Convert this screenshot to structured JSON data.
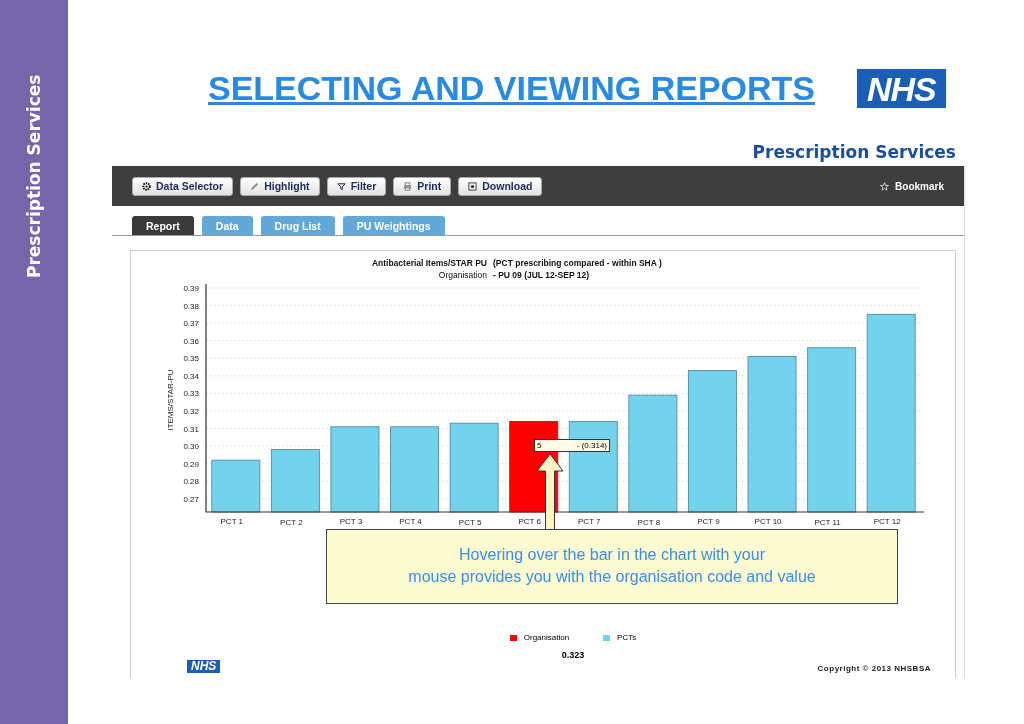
{
  "sidebar": {
    "title": "Prescription Services"
  },
  "slide": {
    "title": "SELECTING AND VIEWING REPORTS",
    "logo": "NHS",
    "subtitle": "Prescription Services"
  },
  "toolbar": {
    "buttons": [
      {
        "label": "Data Selector",
        "kind": "selector"
      },
      {
        "label": "Highlight",
        "kind": "pencil"
      },
      {
        "label": "Filter",
        "kind": "funnel"
      },
      {
        "label": "Print",
        "kind": "printer"
      },
      {
        "label": "Download",
        "kind": "download"
      }
    ],
    "bookmark": "Bookmark"
  },
  "tabs": [
    {
      "label": "Report",
      "selected": true
    },
    {
      "label": "Data",
      "selected": false
    },
    {
      "label": "Drug List",
      "selected": false
    },
    {
      "label": "PU Weightings",
      "selected": false
    }
  ],
  "chart": {
    "title_extra": "(PCT prescribing compared - within SHA )",
    "caption": "Organisation",
    "period": "- PU 09 (JUL 12-SEP 12)",
    "chart_data": {
      "type": "bar",
      "title": "Antibacterial Items/STAR PU",
      "ylabel": "ITEMS/STAR-PU",
      "stacked": true,
      "categories": [
        "PCT 1",
        "PCT 2",
        "PCT 3",
        "PCT 4",
        "PCT 5",
        "PCT 6",
        "PCT 7",
        "PCT 8",
        "PCT 9",
        "PCT 10",
        "PCT 11",
        "PCT 12"
      ],
      "series": [
        {
          "name": "Organisation",
          "color": "#ff0000",
          "values": [
            null,
            null,
            null,
            null,
            null,
            0.314,
            null,
            null,
            null,
            null,
            null,
            null
          ]
        },
        {
          "name": "PCTs",
          "color": "#74d3ec",
          "values": [
            0.292,
            0.298,
            0.311,
            0.311,
            0.313,
            null,
            0.314,
            0.329,
            0.343,
            0.351,
            0.356,
            0.375
          ]
        }
      ],
      "ylim": [
        0.2625,
        0.39
      ],
      "grid": true,
      "yticks": [
        {
          "value": 0.27,
          "label": "0.27"
        },
        {
          "value": 0.28,
          "label": "0.28"
        },
        {
          "value": 0.29,
          "label": "0.29"
        },
        {
          "value": 0.3,
          "label": "0.30"
        },
        {
          "value": 0.31,
          "label": "0.31"
        },
        {
          "value": 0.32,
          "label": "0.32"
        },
        {
          "value": 0.33,
          "label": "0.33"
        },
        {
          "value": 0.34,
          "label": "0.34"
        },
        {
          "value": 0.35,
          "label": "0.35"
        },
        {
          "value": 0.36,
          "label": "0.36"
        },
        {
          "value": 0.37,
          "label": "0.37"
        },
        {
          "value": 0.38,
          "label": "0.38"
        },
        {
          "value": 0.39,
          "label": "0.39"
        }
      ]
    },
    "tooltip": {
      "code": "5",
      "value": "- (0.314)"
    },
    "average": "0.323"
  },
  "callout": {
    "lines": [
      "Hovering over the bar in the chart with your",
      "mouse provides you with the organisation code and value"
    ]
  },
  "footer": {
    "logo": "NHS",
    "copyright": "Copyright © 2013 NHSBSA"
  }
}
